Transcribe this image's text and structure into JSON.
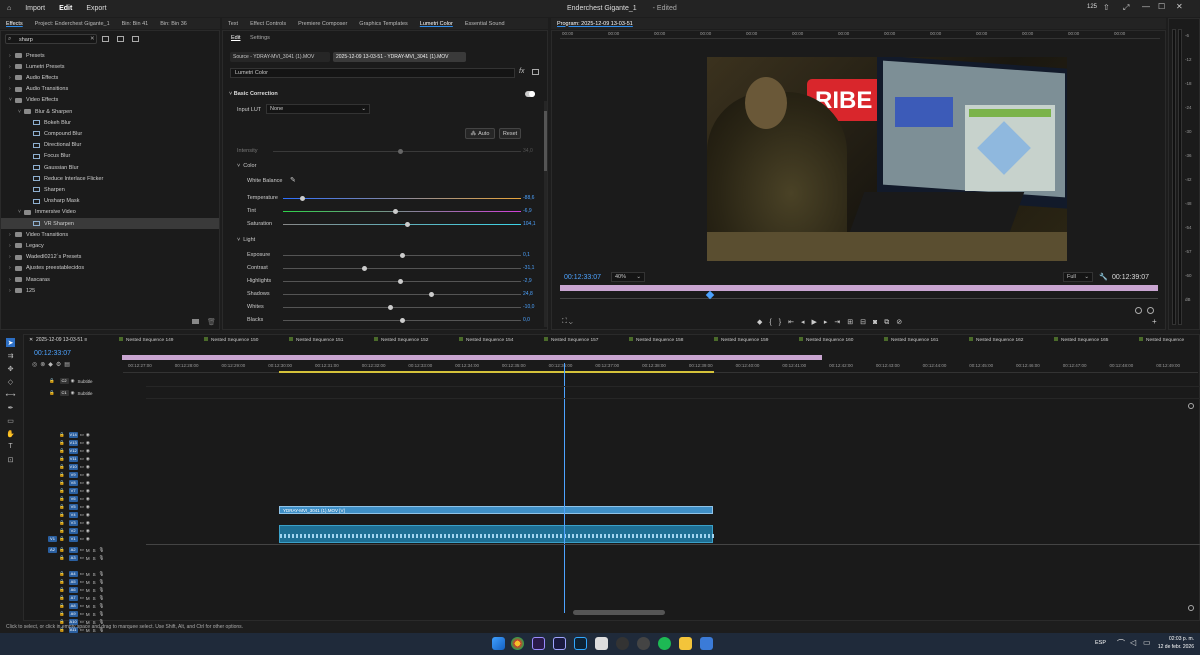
{
  "menubar": {
    "import": "Import",
    "edit": "Edit",
    "export": "Export",
    "title": "Enderchest Gigante_1",
    "edited": "- Edited",
    "badge": "125"
  },
  "effects_panel": {
    "tabs": [
      "Effects",
      "Project: Enderchest Gigante_1",
      "Bin: Bin 41",
      "Bin: Bin 36"
    ],
    "search_value": "sharp",
    "items": [
      {
        "label": "Presets",
        "indent": 0,
        "type": "folder",
        "open": false
      },
      {
        "label": "Lumetri Presets",
        "indent": 0,
        "type": "folder",
        "open": false
      },
      {
        "label": "Audio Effects",
        "indent": 0,
        "type": "folder",
        "open": false
      },
      {
        "label": "Audio Transitions",
        "indent": 0,
        "type": "folder",
        "open": false
      },
      {
        "label": "Video Effects",
        "indent": 0,
        "type": "folder",
        "open": true
      },
      {
        "label": "Blur & Sharpen",
        "indent": 1,
        "type": "folder",
        "open": true
      },
      {
        "label": "Bokeh Blur",
        "indent": 2,
        "type": "fx"
      },
      {
        "label": "Compound Blur",
        "indent": 2,
        "type": "fx"
      },
      {
        "label": "Directional Blur",
        "indent": 2,
        "type": "fx"
      },
      {
        "label": "Focus Blur",
        "indent": 2,
        "type": "fx"
      },
      {
        "label": "Gaussian Blur",
        "indent": 2,
        "type": "fx"
      },
      {
        "label": "Reduce Interlace Flicker",
        "indent": 2,
        "type": "fx"
      },
      {
        "label": "Sharpen",
        "indent": 2,
        "type": "fx"
      },
      {
        "label": "Unsharp Mask",
        "indent": 2,
        "type": "fx"
      },
      {
        "label": "Immersive Video",
        "indent": 1,
        "type": "folder",
        "open": true
      },
      {
        "label": "VR Sharpen",
        "indent": 2,
        "type": "fx",
        "selected": true
      },
      {
        "label": "Video Transitions",
        "indent": 0,
        "type": "folder",
        "open": false
      },
      {
        "label": "Legacy",
        "indent": 0,
        "type": "folder",
        "open": false
      },
      {
        "label": "Wadedl0212´s Presets",
        "indent": 0,
        "type": "folder",
        "open": false
      },
      {
        "label": "Ajustes preestablecidos",
        "indent": 0,
        "type": "folder",
        "open": false
      },
      {
        "label": "Mascaras",
        "indent": 0,
        "type": "folder",
        "open": false
      },
      {
        "label": "125",
        "indent": 0,
        "type": "folder",
        "open": false
      }
    ]
  },
  "lumetri": {
    "tabs": [
      "Text",
      "Effect Controls",
      "Premiere Composer",
      "Graphics Templates",
      "Lumetri Color",
      "Essential Sound"
    ],
    "subtabs": [
      "Edit",
      "Settings"
    ],
    "source_chip": "Source - YDRAY-MVI_3041 (1).MOV",
    "seq_chip": "2025-12-09 13-03-51 - YDRAY-MVI_3041 (1).MOV",
    "effect_select": "Lumetri Color",
    "basic_correction": "Basic Correction",
    "input_lut_label": "Input LUT",
    "input_lut_value": "None",
    "auto": "Auto",
    "reset": "Reset",
    "intensity_label": "Intensity",
    "intensity_value": "34,0",
    "color_section": "Color",
    "white_balance": "White Balance",
    "color_sliders": [
      {
        "label": "Temperature",
        "value": "-88,6",
        "pos": 0.08
      },
      {
        "label": "Tint",
        "value": "-6,9",
        "pos": 0.47
      },
      {
        "label": "Saturation",
        "value": "104,1",
        "pos": 0.52
      }
    ],
    "light_section": "Light",
    "light_sliders": [
      {
        "label": "Exposure",
        "value": "0,1",
        "pos": 0.5
      },
      {
        "label": "Contrast",
        "value": "-31,1",
        "pos": 0.34
      },
      {
        "label": "Highlights",
        "value": "-2,9",
        "pos": 0.49
      },
      {
        "label": "Shadows",
        "value": "24,8",
        "pos": 0.62
      },
      {
        "label": "Whites",
        "value": "-10,0",
        "pos": 0.45
      },
      {
        "label": "Blacks",
        "value": "0,0",
        "pos": 0.5
      }
    ]
  },
  "program": {
    "title": "Program: 2025-12-09 13-03-51",
    "timecode": "00:12:33:07",
    "zoom": "40%",
    "quality": "Full",
    "duration": "00:12:39:07",
    "ruler_ticks": [
      "00:00",
      "00:00",
      "00:00",
      "00:00",
      "00:00",
      "00:00",
      "00:00",
      "00:00",
      "00:00",
      "00:00",
      "00:00",
      "00:00",
      "00:00"
    ],
    "video_label": "RIBE"
  },
  "meter": {
    "ticks": [
      "-6",
      "-12",
      "-18",
      "-24",
      "-30",
      "-36",
      "-42",
      "-48",
      "-54",
      "-57",
      "-60",
      "dB"
    ]
  },
  "timeline": {
    "sequence_tab": "2025-12-09 13-03-51",
    "timecode": "00:12:33:07",
    "nested": [
      "Nested Sequence 149",
      "Nested Sequence 150",
      "Nested Sequence 151",
      "Nested Sequence 152",
      "Nested Sequence 154",
      "Nested Sequence 157",
      "Nested Sequence 158",
      "Nested Sequence 159",
      "Nested Sequence 160",
      "Nested Sequence 161",
      "Nested Sequence 162",
      "Nested Sequence 165",
      "Nested Sequence"
    ],
    "ruler": [
      "00:12:27:00",
      "00:12:28:00",
      "00:12:29:00",
      "00:12:30:00",
      "00:12:31:00",
      "00:12:32:00",
      "00:12:33:00",
      "00:12:34:00",
      "00:12:35:00",
      "00:12:36:00",
      "00:12:37:00",
      "00:12:38:00",
      "00:12:39:00",
      "00:12:40:00",
      "00:12:41:00",
      "00:12:42:00",
      "00:12:43:00",
      "00:12:44:00",
      "00:12:45:00",
      "00:12:46:00",
      "00:12:47:00",
      "00:12:48:00",
      "00:12:49:00"
    ],
    "subtitle_tracks": [
      "C2",
      "C1"
    ],
    "subtitle_label": "Subtitle",
    "video_tracks": [
      "V14",
      "V13",
      "V12",
      "V11",
      "V10",
      "V9",
      "V8",
      "V7",
      "V6",
      "V5",
      "V4",
      "V3",
      "V2",
      "V1"
    ],
    "audio_tracks": [
      "A2",
      "A3",
      "A4",
      "A5",
      "A6",
      "A7",
      "A8",
      "A9",
      "A10",
      "A11"
    ],
    "v1_src": "V1",
    "a2_src": "A2",
    "clip_label": "YDRAY-MVI_3041 (1).MOV [V]",
    "playhead_fraction": 0.41
  },
  "statusbar": {
    "text": "Click to select, or click in empty space and drag to marquee select. Use Shift, Alt, and Ctrl for other options."
  },
  "taskbar": {
    "lang": "ESP",
    "time": "02:03 p. m.",
    "date": "12 de febr. 2026"
  }
}
